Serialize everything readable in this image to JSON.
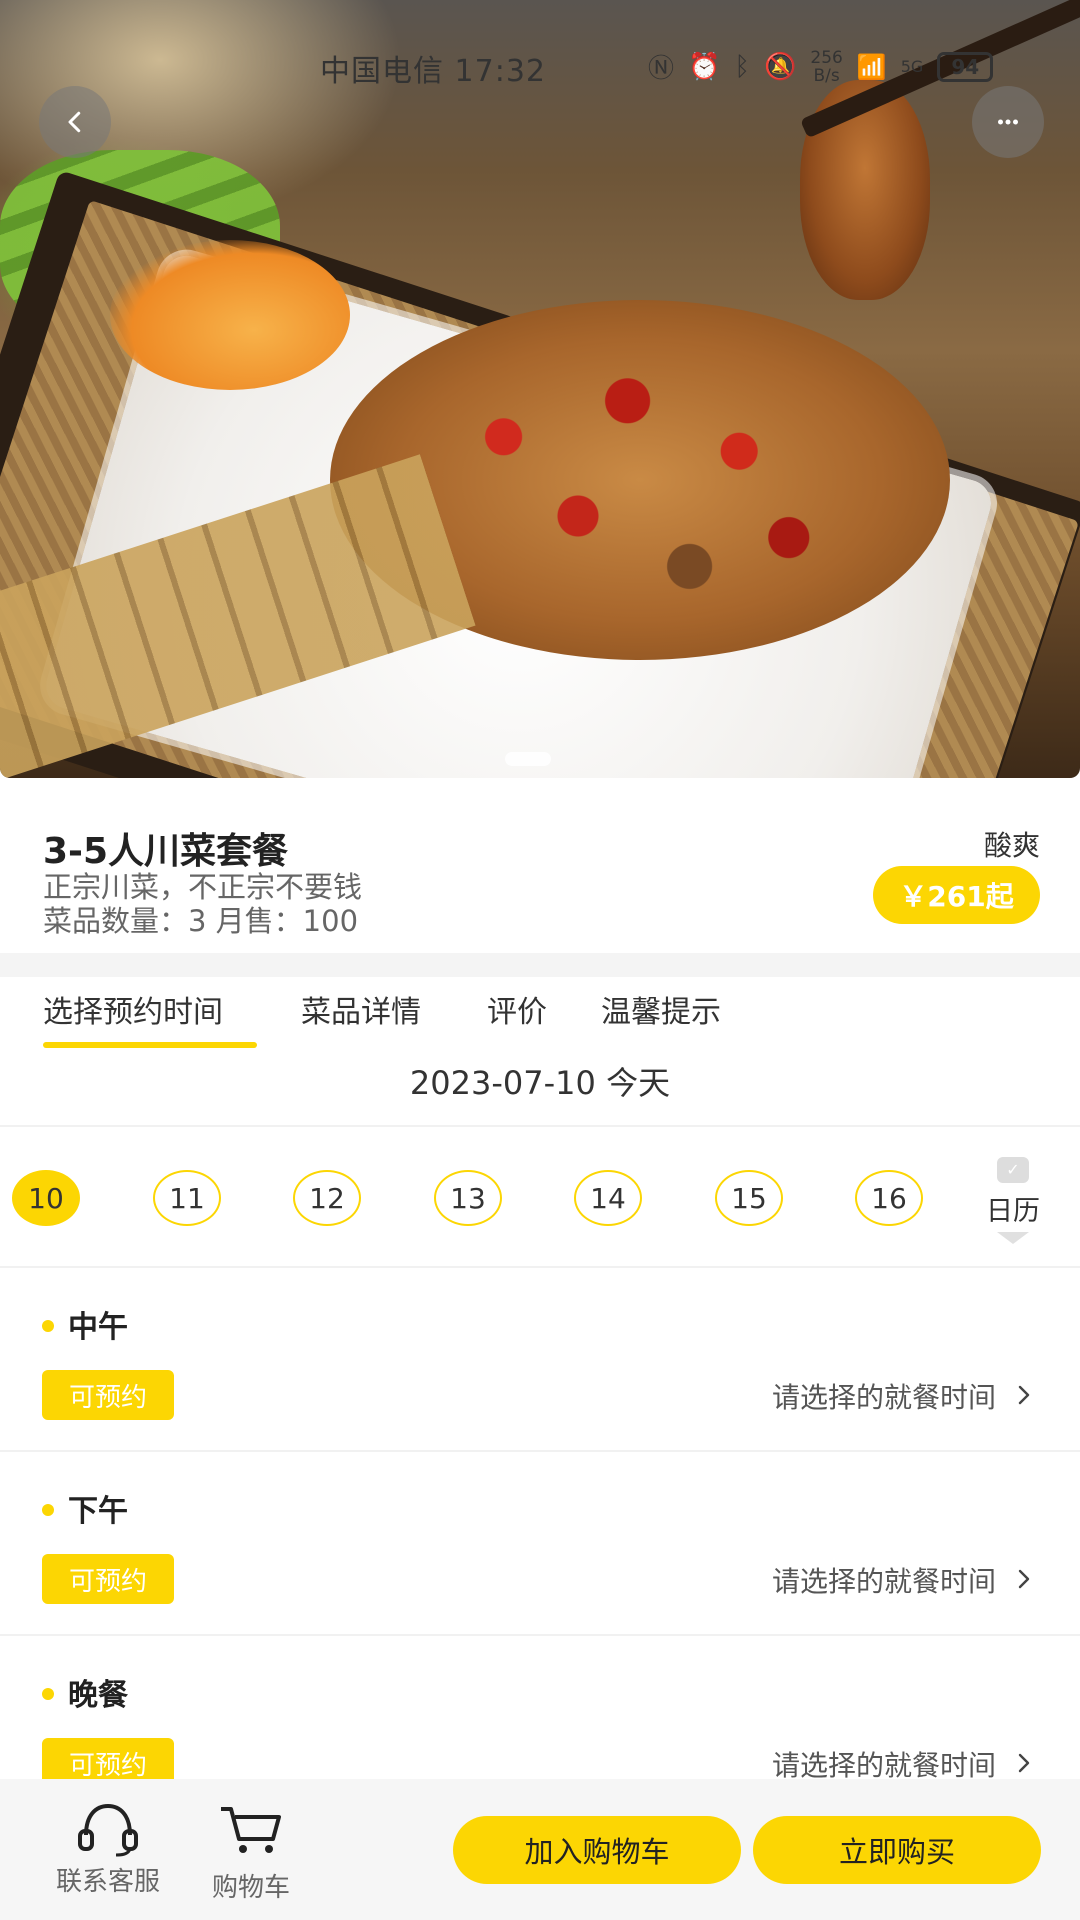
{
  "status_bar": {
    "carrier_time": "中国电信 17:32",
    "icons": [
      "nfc-icon",
      "alarm-icon",
      "bluetooth-icon",
      "mute-icon"
    ],
    "net_speed_top": "256",
    "net_speed_bottom": "B/s",
    "network": "5G",
    "battery": "94"
  },
  "header": {
    "back_icon": "chevron-left-icon",
    "more_icon": "more-dots-icon"
  },
  "product": {
    "title": "3-5人川菜套餐",
    "subtitle": "正宗川菜，不正宗不要钱",
    "meta": "菜品数量：3 月售：100",
    "tag": "酸爽",
    "price": "￥261起"
  },
  "tabs": [
    {
      "label": "选择预约时间",
      "active": true
    },
    {
      "label": "菜品详情",
      "active": false
    },
    {
      "label": "评价",
      "active": false
    },
    {
      "label": "温馨提示",
      "active": false
    }
  ],
  "date_line": "2023-07-10 今天",
  "days": [
    "10",
    "11",
    "12",
    "13",
    "14",
    "15",
    "16"
  ],
  "selected_day": "10",
  "calendar_label": "日历",
  "slots": [
    {
      "title": "中午",
      "badge": "可预约",
      "hint": "请选择的就餐时间"
    },
    {
      "title": "下午",
      "badge": "可预约",
      "hint": "请选择的就餐时间"
    },
    {
      "title": "晚餐",
      "badge": "可预约",
      "hint": "请选择的就餐时间"
    }
  ],
  "bottom_bar": {
    "service_label": "联系客服",
    "cart_label": "购物车",
    "add_cart": "加入购物车",
    "buy_now": "立即购买"
  },
  "colors": {
    "accent": "#fcd603",
    "text_primary": "#222222",
    "text_secondary": "#666666"
  }
}
